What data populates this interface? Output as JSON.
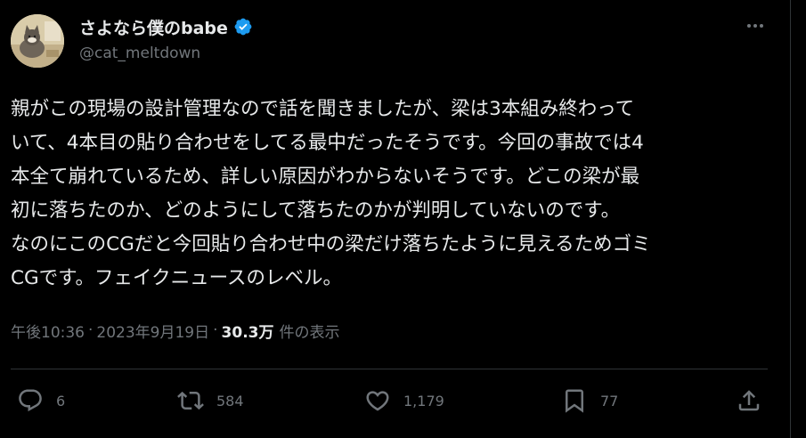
{
  "user": {
    "display_name": "さよなら僕のbabe",
    "handle": "@cat_meltdown",
    "verified_color": "#1d9bf0"
  },
  "tweet": {
    "lines": [
      "親がこの現場の設計管理なので話を聞きましたが、梁は3本組み終わって",
      "いて、4本目の貼り合わせをしてる最中だったそうです。今回の事故では4",
      "本全て崩れているため、詳しい原因がわからないそうです。どこの梁が最",
      "初に落ちたのか、どのようにして落ちたのかが判明していないのです。",
      "なのにこのCGだと今回貼り合わせ中の梁だけ落ちたように見えるためゴミ",
      "CGです。フェイクニュースのレベル。"
    ]
  },
  "meta": {
    "time": "午後10:36",
    "separator": "·",
    "date": "2023年9月19日",
    "views_count": "30.3万",
    "views_label": "件の表示"
  },
  "actions": {
    "reply_count": "6",
    "retweet_count": "584",
    "like_count": "1,179",
    "bookmark_count": "77"
  },
  "icons": {
    "avatar": "cat-avatar",
    "verified": "verified-badge-icon",
    "more": "more-icon",
    "reply": "reply-icon",
    "retweet": "retweet-icon",
    "like": "heart-icon",
    "bookmark": "bookmark-icon",
    "share": "share-icon"
  },
  "colors": {
    "background": "#000000",
    "text": "#e7e9ea",
    "secondary_text": "#71767b",
    "divider": "#2f3336"
  }
}
